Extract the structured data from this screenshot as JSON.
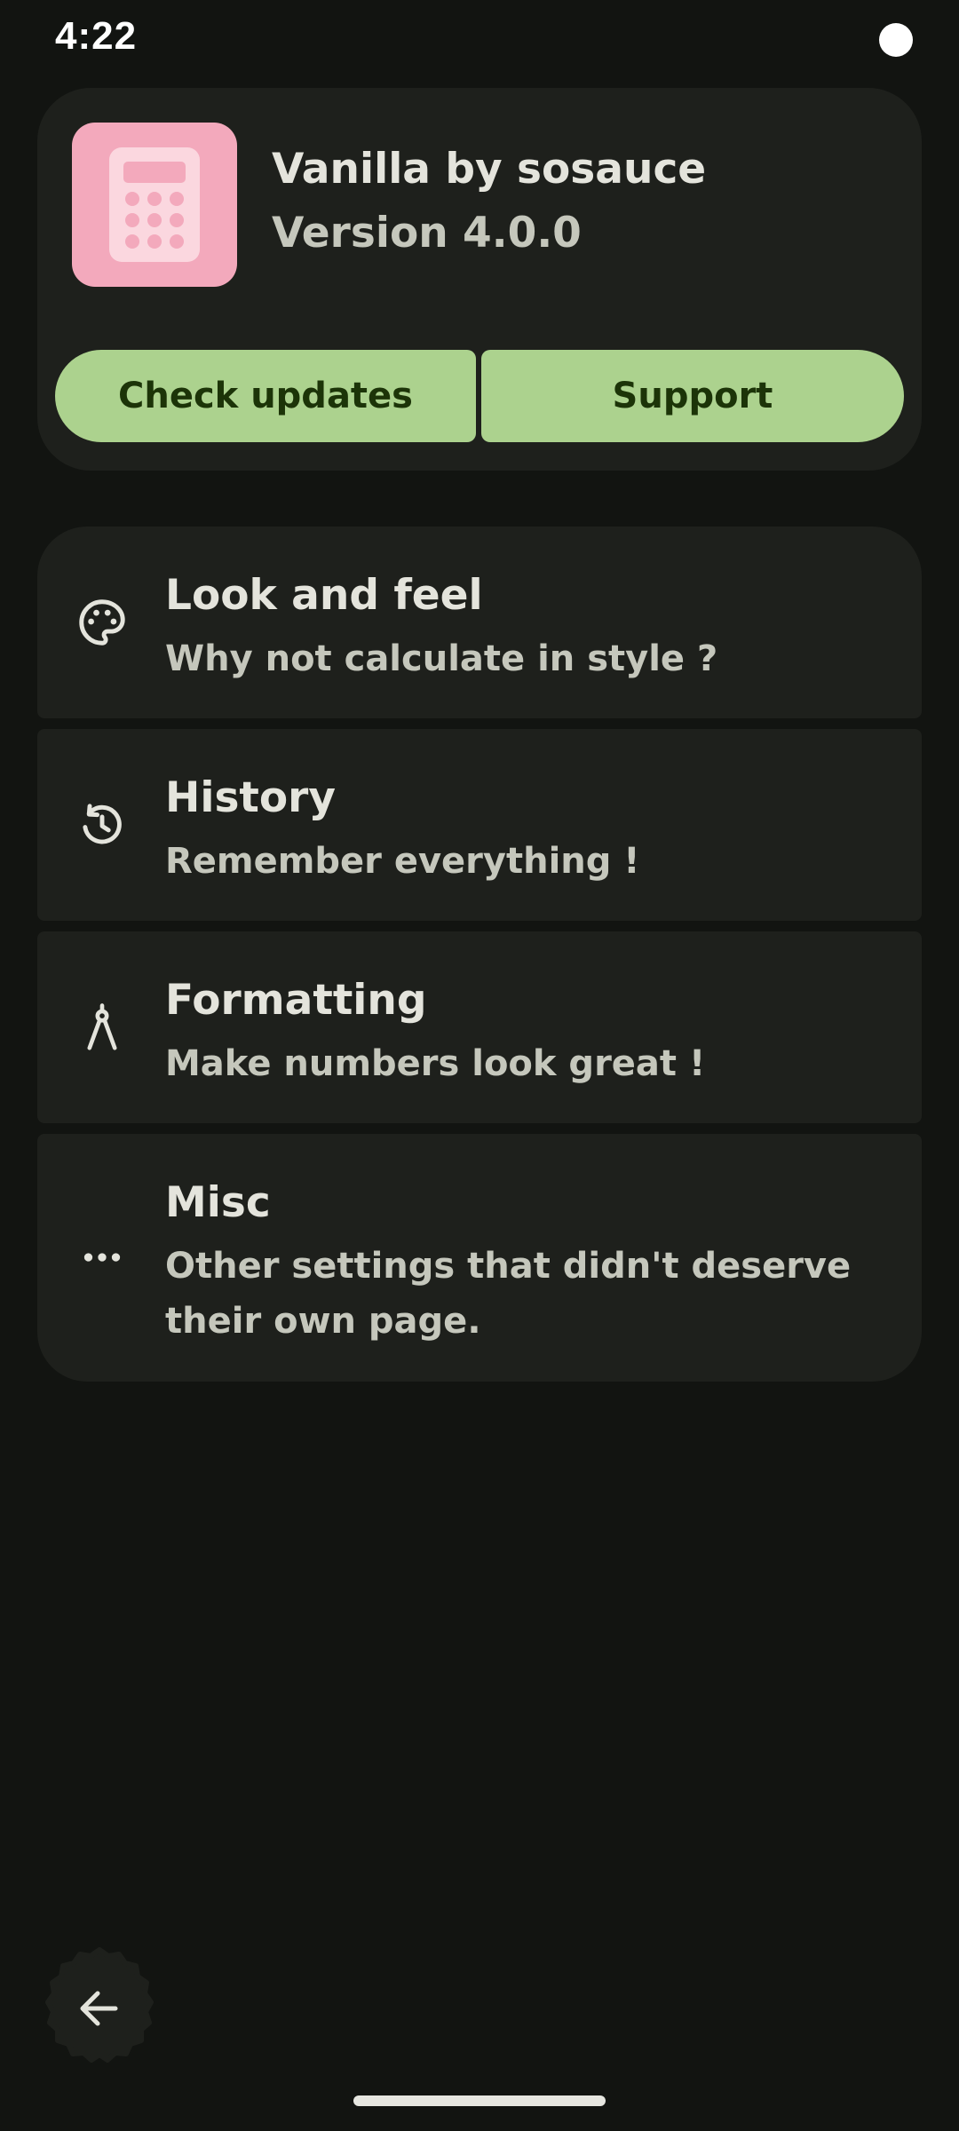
{
  "status_bar": {
    "time": "4:22"
  },
  "header": {
    "app_name": "Vanilla by sosauce",
    "version": "Version 4.0.0",
    "check_updates_label": "Check updates",
    "support_label": "Support",
    "icon": "calculator-icon"
  },
  "menu": {
    "items": [
      {
        "title": "Look and feel",
        "subtitle": "Why not calculate in style ?",
        "icon": "palette-icon"
      },
      {
        "title": "History",
        "subtitle": "Remember everything !",
        "icon": "history-icon"
      },
      {
        "title": "Formatting",
        "subtitle": "Make numbers look great !",
        "icon": "compass-icon"
      },
      {
        "title": "Misc",
        "subtitle": "Other settings that didn't deserve their own page.",
        "icon": "more-horiz-icon"
      }
    ]
  },
  "navigation": {
    "back_icon": "arrow-back-icon"
  },
  "colors": {
    "background": "#121411",
    "surface": "#1e201c",
    "accent": "#acd28e",
    "on_accent": "#1c3408",
    "icon_bg": "#f3a9bc"
  }
}
